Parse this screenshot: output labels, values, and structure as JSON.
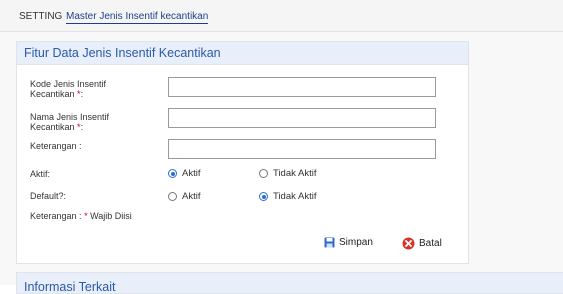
{
  "breadcrumb": {
    "setting": "SETTING",
    "current": "Master Jenis Insentif kecantikan"
  },
  "form": {
    "title": "Fitur Data Jenis Insentif Kecantikan",
    "kode_label_1": "Kode Jenis Insentif",
    "kode_label_2": "Kecantikan",
    "kode_value": "",
    "nama_label_1": "Nama Jenis Insentif",
    "nama_label_2": "Kecantikan",
    "nama_value": "",
    "keterangan_label": "Keterangan :",
    "keterangan_value": "",
    "required_mark": "*",
    "colon": ":",
    "aktif_label": "Aktif:",
    "aktif_options": [
      "Aktif",
      "Tidak Aktif"
    ],
    "aktif_selected": "Aktif",
    "default_label": "Default?:",
    "default_options": [
      "Aktif",
      "Tidak Aktif"
    ],
    "default_selected": "Tidak Aktif",
    "note_prefix": "Keterangan :",
    "note_mark": "*",
    "note_text": "Wajib Diisi",
    "save_label": "Simpan",
    "cancel_label": "Batal"
  },
  "info_panel": {
    "title": "Informasi Terkait"
  },
  "colors": {
    "accent": "#2a5aa8",
    "required": "#d0021b",
    "radio_checked": "#2b6fd6"
  }
}
